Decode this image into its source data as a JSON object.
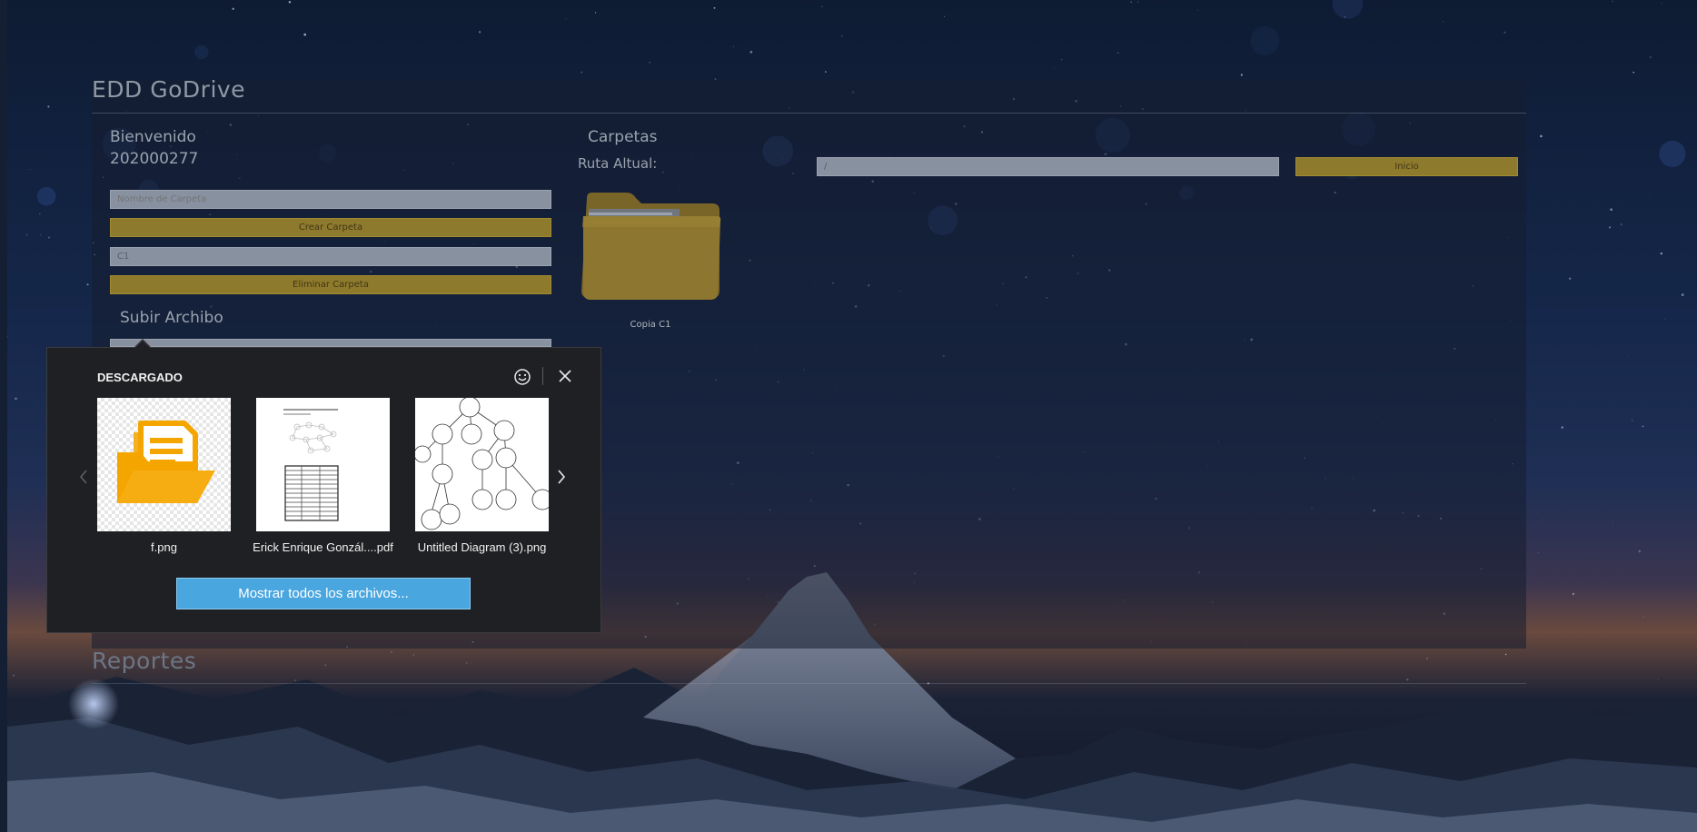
{
  "app": {
    "title": "EDD GoDrive",
    "reports_title": "Reportes"
  },
  "sidebar": {
    "welcome": "Bienvenido",
    "user_id": "202000277",
    "folder_name_placeholder": "Nombre de Carpeta",
    "create_folder_label": "Crear Carpeta",
    "delete_folder_value": "C1",
    "delete_folder_label": "Eliminar Carpeta",
    "upload_title": "Subir Archibo"
  },
  "folders": {
    "title": "Carpetas",
    "path_label": "Ruta Altual:",
    "path_value": "/",
    "home_button": "Inicio",
    "items": [
      {
        "name": "Copia C1"
      }
    ]
  },
  "downloads": {
    "header": "DESCARGADO",
    "items": [
      {
        "name": "f.png"
      },
      {
        "name": "Erick Enrique Gonzál....pdf"
      },
      {
        "name": "Untitled Diagram (3).png"
      }
    ],
    "show_all_label": "Mostrar todos los archivos...",
    "icons": {
      "feedback": "smiley-icon",
      "close": "close-icon",
      "prev": "chevron-left-icon",
      "next": "chevron-right-icon"
    }
  },
  "colors": {
    "accent_button": "#8e7a2c",
    "show_all_button": "#4aa6df",
    "popup_background": "#1f2023"
  }
}
